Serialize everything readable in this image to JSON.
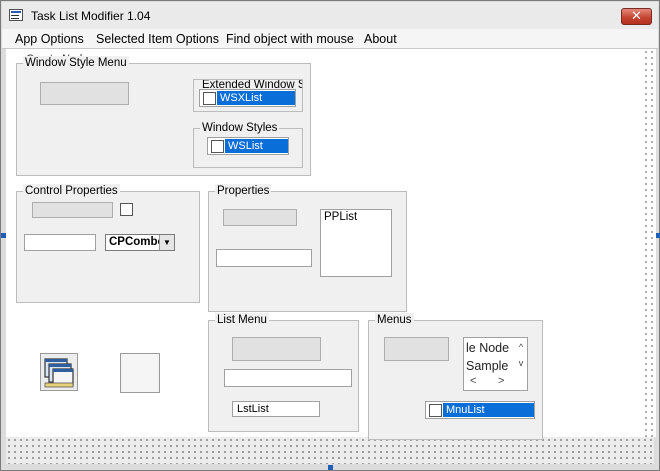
{
  "window": {
    "title": "Task List Modifier 1.04",
    "close_glyph": "✕",
    "icon": "app-window-icon"
  },
  "menu": {
    "items": [
      "App Options",
      "Selected Item Options",
      "Find object with mouse",
      "About"
    ]
  },
  "top_partial_text": "Create Node",
  "window_style_menu": {
    "label": "Window Style Menu",
    "extended_label": "Extended Window Sty",
    "extended_list_item": "WSXList",
    "styles_label": "Window Styles",
    "styles_list_item": "WSList"
  },
  "control_properties": {
    "label": "Control Properties",
    "combo_value": "CPCombo",
    "combo_arrow": "▼"
  },
  "properties": {
    "label": "Properties",
    "list_item": "PPList"
  },
  "list_menu": {
    "label": "List Menu",
    "list_item": "LstList"
  },
  "menus": {
    "label": "Menus",
    "tree_lines": [
      "le Node",
      "Sample"
    ],
    "scroll_up": "^",
    "scroll_down": "v",
    "scroll_left": "<",
    "scroll_right": ">",
    "list_item": "MnuList"
  },
  "colors": {
    "selection": "#0a6ed8",
    "close_button": "#c54632",
    "handles": "#1c5fb8"
  }
}
